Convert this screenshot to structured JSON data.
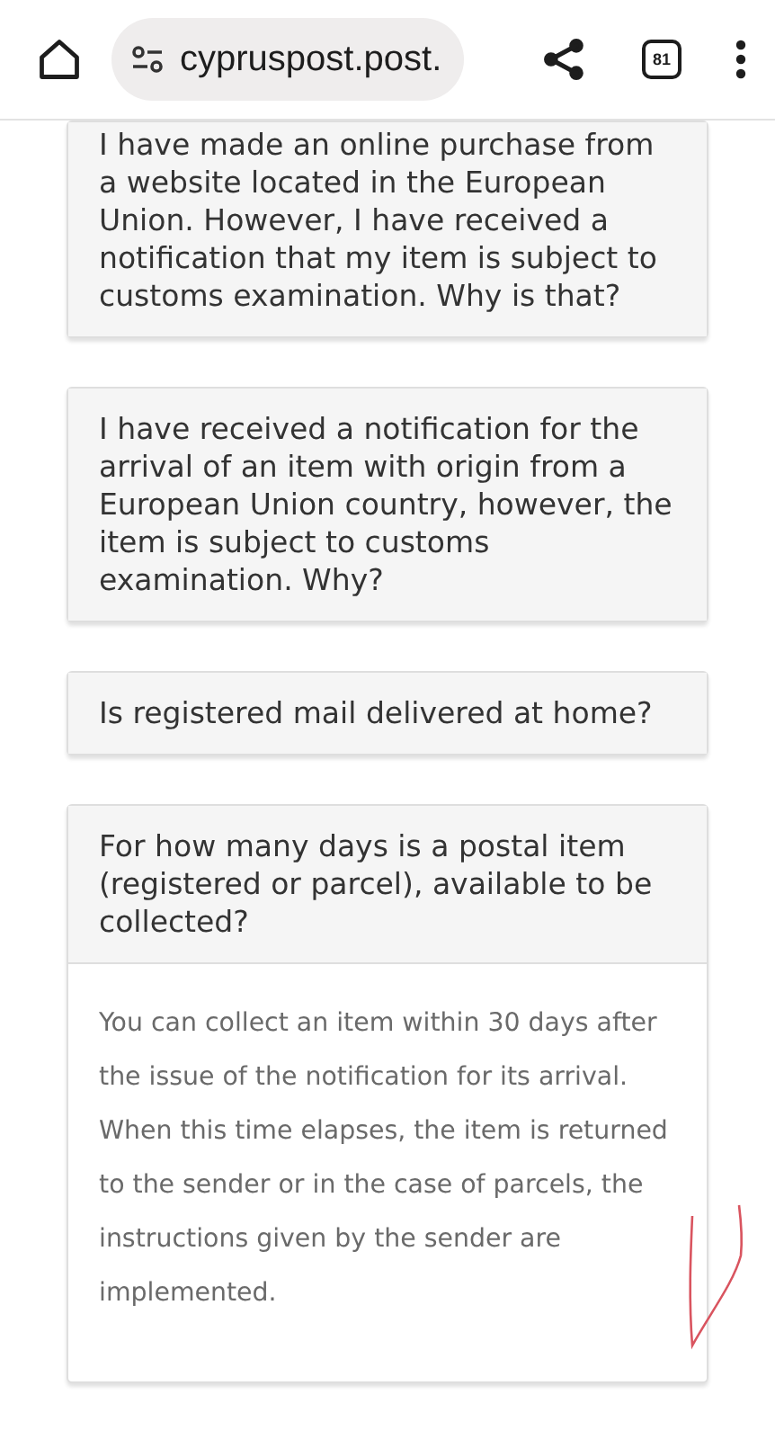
{
  "browser_bar": {
    "url": "cypruspost.post.",
    "tab_count": "81"
  },
  "faq_items": [
    {
      "question": "I have made an online purchase from a website located in the European Union. However, I have received a notification that my item is subject to customs examination. Why is that?",
      "expanded": false
    },
    {
      "question": "I have received a notification for the arrival of an item with origin from a European Union country, however, the item is subject to customs examination. Why?",
      "expanded": false
    },
    {
      "question": "Is registered mail delivered at home?",
      "expanded": false
    },
    {
      "question": "For how many days is a postal item (registered or parcel), available to be collected?",
      "expanded": true,
      "answer": "You can collect an item within 30 days after the issue of the notification for its arrival. When this time elapses, the item is returned to the sender or in the case of parcels, the instructions given by the sender are implemented."
    }
  ]
}
